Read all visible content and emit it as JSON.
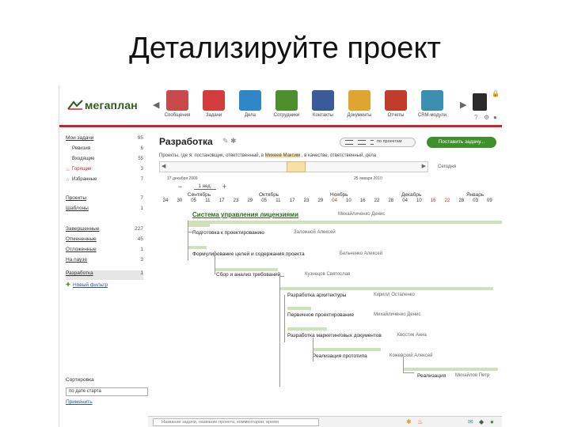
{
  "slide": {
    "title": "Детализируйте проект"
  },
  "app": {
    "logo_text": "мегаплан",
    "nav_items": [
      {
        "label": "Сообщения",
        "color": "#c94a4a"
      },
      {
        "label": "Задачи",
        "color": "#d23c3c"
      },
      {
        "label": "Дела",
        "color": "#2f86c8"
      },
      {
        "label": "Сотрудники",
        "color": "#4d8f2c"
      },
      {
        "label": "Контакты",
        "color": "#3a5a9a"
      },
      {
        "label": "Документы",
        "color": "#e0a430"
      },
      {
        "label": "Отчеты",
        "color": "#c23c2c"
      },
      {
        "label": "CRM-модули",
        "color": "#3c8fb0"
      }
    ]
  },
  "sidebar": {
    "items": [
      {
        "label": "Мои задачи",
        "count": "95"
      },
      {
        "label": "Ревизия",
        "count": "6",
        "sub": true
      },
      {
        "label": "Входящие",
        "count": "55",
        "sub": true
      },
      {
        "label": "Горящие",
        "count": "3",
        "sub": true,
        "hot": true
      },
      {
        "label": "Избранные",
        "count": "7",
        "sub": true,
        "star": true
      },
      {
        "label": "Проекты",
        "count": "7"
      },
      {
        "label": "Шаблоны",
        "count": "1"
      },
      {
        "label": "Завершенные",
        "count": "227"
      },
      {
        "label": "Отмененные",
        "count": "45"
      },
      {
        "label": "Отложенные",
        "count": "1"
      },
      {
        "label": "На паузе",
        "count": "3"
      },
      {
        "label": "Разработка",
        "count": "1",
        "active": true
      },
      {
        "label": "Новый фильтр",
        "count": ""
      }
    ],
    "sort_label": "Сортировка",
    "sort_value": "по дате старта",
    "apply_link": "Применить"
  },
  "main": {
    "heading": "Разработка",
    "view_label": "по проектам",
    "add_task": "Поставить задачу...",
    "breadcrumbs": {
      "prefix": "Проекты, где я: постановщик, ответственный, в",
      "participants": "Михеев Максим",
      "rest": ", в качестве, ответственный, дела"
    },
    "today": "Сегодня",
    "date_from": "17 декабря 2009",
    "date_to": "25 января 2010",
    "zoom_label": "1 нед.",
    "months": [
      "Сентябрь",
      "Октябрь",
      "Ноябрь",
      "Декабрь",
      "Январь"
    ],
    "days": [
      {
        "d": "24"
      },
      {
        "d": "30"
      },
      {
        "d": "05"
      },
      {
        "d": "11"
      },
      {
        "d": "17"
      },
      {
        "d": "23"
      },
      {
        "d": "29"
      },
      {
        "d": "05"
      },
      {
        "d": "11"
      },
      {
        "d": "17"
      },
      {
        "d": "23"
      },
      {
        "d": "29"
      },
      {
        "d": "04",
        "red": true
      },
      {
        "d": "10"
      },
      {
        "d": "16"
      },
      {
        "d": "22"
      },
      {
        "d": "28"
      },
      {
        "d": "04"
      },
      {
        "d": "10"
      },
      {
        "d": "16",
        "red": true
      },
      {
        "d": "22",
        "red": true
      },
      {
        "d": "28"
      },
      {
        "d": "03"
      },
      {
        "d": "09"
      }
    ],
    "tasks": [
      {
        "title": "Система управления лицензиями",
        "owner": "Михайличенко Денис",
        "main": true
      },
      {
        "title": "Подготовка к проектированию",
        "owner": "Заложной Алексей"
      },
      {
        "title": "Формулирование целей и содержания проекта",
        "owner": "Бельченко Алексей"
      },
      {
        "title": "Сбор и анализ требований",
        "owner": "Кузнецов Святослав"
      },
      {
        "title": "Разработка архитектуры",
        "owner": "Кирилл Остапенко"
      },
      {
        "title": "Первичное проектирование",
        "owner": "Михайличенко Денис"
      },
      {
        "title": "Разработка маркетинговых документов",
        "owner": "Хвостик Анна"
      },
      {
        "title": "Реализация прототипа",
        "owner": "Кожевский Алексей"
      },
      {
        "title": "Реализация",
        "owner": "Михайлов Петр"
      }
    ]
  },
  "bottombar": {
    "search_placeholder": "Название задачи, название проекта, комментарии, время"
  }
}
